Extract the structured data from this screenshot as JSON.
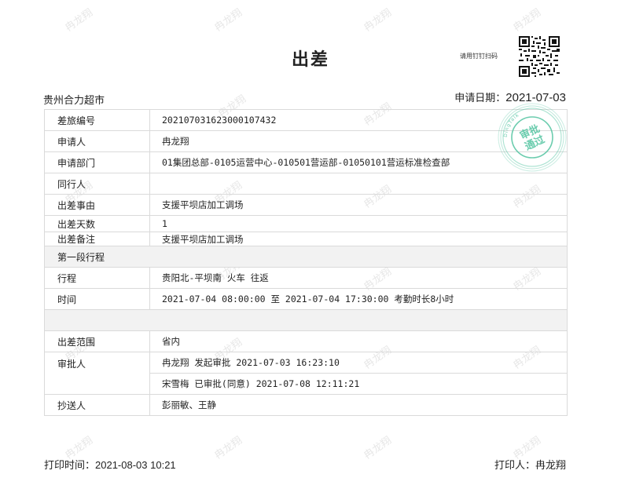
{
  "watermark_text": "冉龙翔",
  "title": "出差",
  "qr_hint": "请用钉钉扫码",
  "company": "贵州合力超市",
  "apply_date_label": "申请日期：",
  "apply_date": "2021-07-03",
  "stamp": {
    "line1": "审批",
    "line2": "通过",
    "ring_text": "DingTalk",
    "color": "#52c4a0"
  },
  "rows": [
    {
      "label": "差旅编号",
      "value": "202107031623000107432"
    },
    {
      "label": "申请人",
      "value": "冉龙翔"
    },
    {
      "label": "申请部门",
      "value": "01集团总部-0105运营中心-010501营运部-01050101营运标准检查部"
    },
    {
      "label": "同行人",
      "value": ""
    },
    {
      "label": "出差事由",
      "value": "支援平坝店加工调场"
    },
    {
      "label": "出差天数",
      "value": "1"
    },
    {
      "label": "出差备注",
      "value": "支援平坝店加工调场"
    }
  ],
  "section": {
    "label": "第一段行程"
  },
  "trip": [
    {
      "label": "行程",
      "value": "贵阳北-平坝南 火车 往返"
    },
    {
      "label": "时间",
      "value": "2021-07-04 08:00:00 至 2021-07-04 17:30:00 考勤时长8小时"
    }
  ],
  "scope": {
    "label": "出差范围",
    "value": "省内"
  },
  "approval": {
    "label": "审批人",
    "entries": [
      "冉龙翔 发起审批  2021-07-03 16:23:10",
      "宋雪梅 已审批(同意)  2021-07-08 12:11:21"
    ]
  },
  "cc": {
    "label": "抄送人",
    "value": "彭丽敏、王静"
  },
  "print_time_label": "打印时间：",
  "print_time": "2021-08-03 10:21",
  "printer_label": "打印人：",
  "printer": "冉龙翔"
}
